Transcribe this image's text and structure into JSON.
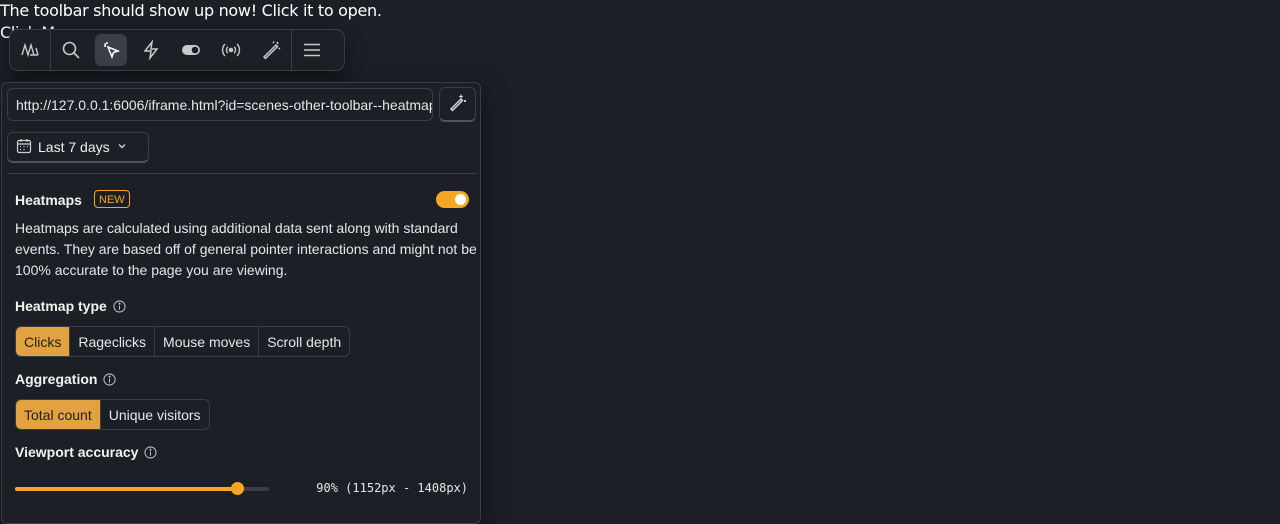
{
  "host": {
    "line1": "The toolbar should show up now! Click it to open.",
    "line2": "Click Me"
  },
  "toolbar": {
    "items": [
      "logo-icon",
      "search-icon",
      "heatmap-cursor-icon",
      "actions-bolt-icon",
      "feature-flag-toggle-icon",
      "broadcast-icon",
      "magic-wand-icon",
      "menu-icon"
    ],
    "active_item": "heatmap-cursor-icon"
  },
  "panel": {
    "url_value": "http://127.0.0.1:6006/iframe.html?id=scenes-other-toolbar--heatmap",
    "date_range": "Last 7 days",
    "heatmaps": {
      "title": "Heatmaps",
      "badge": "NEW",
      "enabled": true,
      "description": "Heatmaps are calculated using additional data sent along with standard events. They are based off of general pointer interactions and might not be 100% accurate to the page you are viewing."
    },
    "heatmap_type": {
      "label": "Heatmap type",
      "options": [
        "Clicks",
        "Rageclicks",
        "Mouse moves",
        "Scroll depth"
      ],
      "selected": "Clicks"
    },
    "aggregation": {
      "label": "Aggregation",
      "options": [
        "Total count",
        "Unique visitors"
      ],
      "selected": "Total count"
    },
    "viewport": {
      "label": "Viewport accuracy",
      "value_fraction": 0.875,
      "readout": "90% (1152px - 1408px)"
    }
  },
  "colors": {
    "accent": "#f5a623",
    "selected_segment": "#e3a240",
    "background": "#1d1f27",
    "border": "#3a3d46"
  }
}
